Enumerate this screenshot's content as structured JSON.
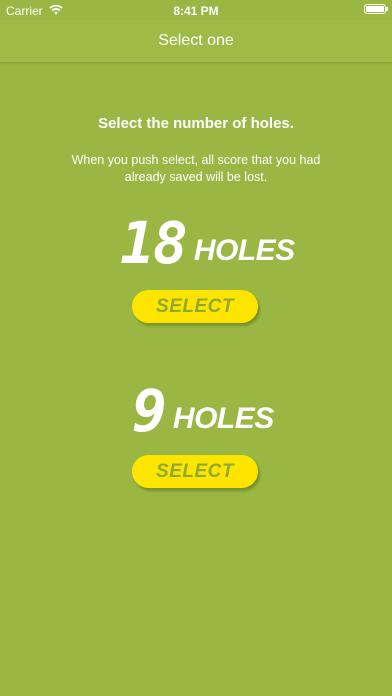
{
  "status_bar": {
    "carrier": "Carrier",
    "time": "8:41 PM",
    "wifi_icon": "wifi-icon",
    "battery_icon": "battery-icon"
  },
  "nav": {
    "title": "Select one"
  },
  "main": {
    "heading": "Select the number of holes.",
    "description": "When you push select, all score that you had already saved will be lost.",
    "options": [
      {
        "number": "18",
        "suffix": "HOLES",
        "button_label": "SELECT"
      },
      {
        "number": "9",
        "suffix": "HOLES",
        "button_label": "SELECT"
      }
    ]
  },
  "colors": {
    "background": "#9ab643",
    "button": "#fee500",
    "button_text": "#8eaa33",
    "text": "#ffffff"
  }
}
